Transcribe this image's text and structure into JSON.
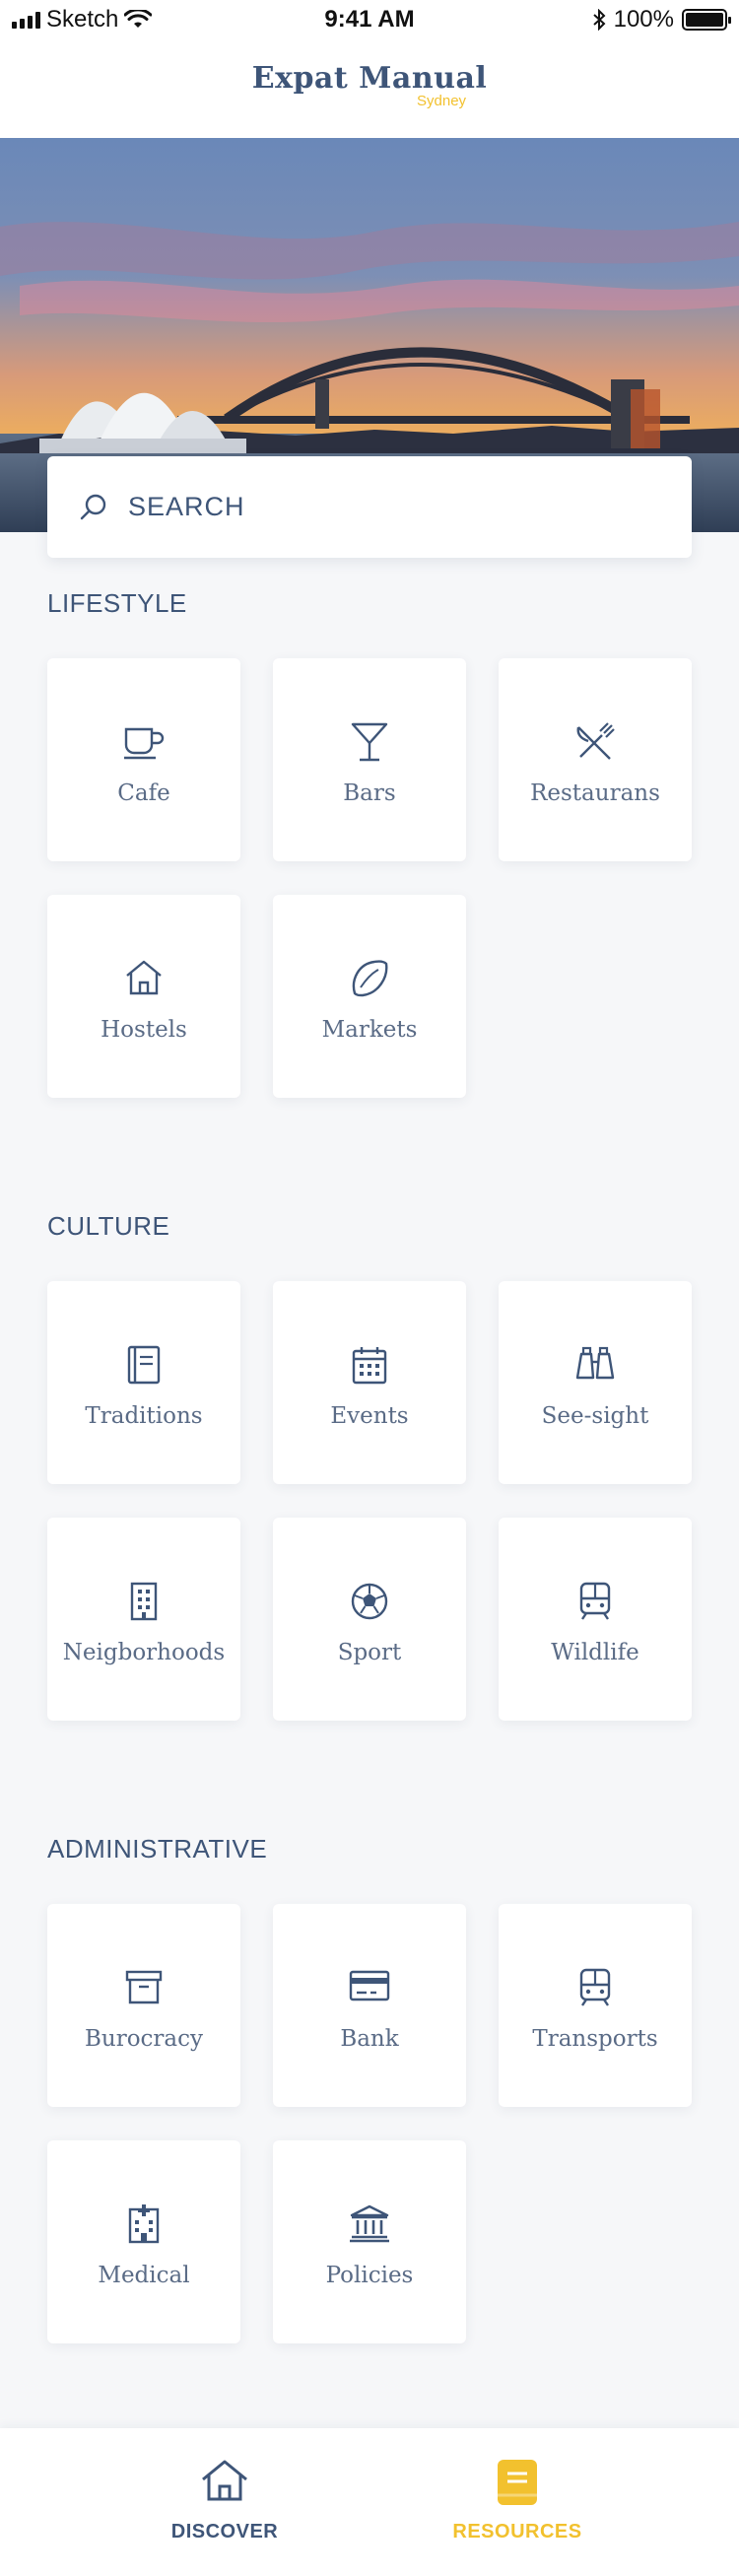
{
  "status_bar": {
    "carrier": "Sketch",
    "time": "9:41 AM",
    "battery": "100%"
  },
  "header": {
    "title": "Expat Manual",
    "city": "Sydney"
  },
  "search": {
    "label": "SEARCH"
  },
  "sections": {
    "lifestyle": {
      "title": "LIFESTYLE",
      "items": [
        {
          "label": "Cafe",
          "icon": "coffee-cup-icon"
        },
        {
          "label": "Bars",
          "icon": "cocktail-glass-icon"
        },
        {
          "label": "Restaurans",
          "icon": "fork-knife-icon"
        },
        {
          "label": "Hostels",
          "icon": "house-icon"
        },
        {
          "label": "Markets",
          "icon": "lemon-icon"
        }
      ]
    },
    "culture": {
      "title": "CULTURE",
      "items": [
        {
          "label": "Traditions",
          "icon": "book-icon"
        },
        {
          "label": "Events",
          "icon": "calendar-icon"
        },
        {
          "label": "See-sight",
          "icon": "binoculars-icon"
        },
        {
          "label": "Neigborhoods",
          "icon": "building-icon"
        },
        {
          "label": "Sport",
          "icon": "soccer-ball-icon"
        },
        {
          "label": "Wildlife",
          "icon": "train-icon"
        }
      ]
    },
    "administrative": {
      "title": "ADMINISTRATIVE",
      "items": [
        {
          "label": "Burocracy",
          "icon": "archive-box-icon"
        },
        {
          "label": "Bank",
          "icon": "credit-card-icon"
        },
        {
          "label": "Transports",
          "icon": "train-icon"
        },
        {
          "label": "Medical",
          "icon": "hospital-icon"
        },
        {
          "label": "Policies",
          "icon": "government-building-icon"
        }
      ]
    }
  },
  "tabbar": {
    "discover": {
      "label": "DISCOVER",
      "icon": "house-icon"
    },
    "resources": {
      "label": "RESOURCES",
      "icon": "book-icon"
    }
  },
  "colors": {
    "primary": "#3e5578",
    "accent": "#f2c12e",
    "background": "#f6f7f9"
  }
}
